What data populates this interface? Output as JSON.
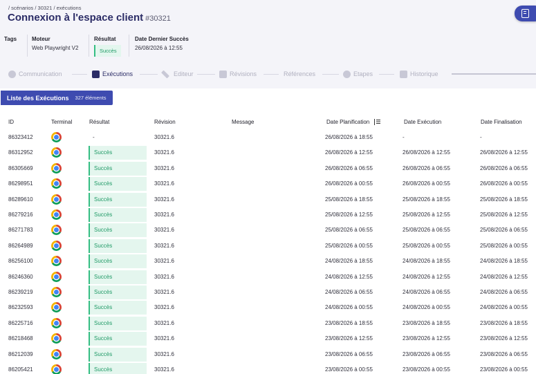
{
  "header": {
    "breadcrumb": "/ scénarios / 30321 / exécutions",
    "title": "Connexion à l'espace client",
    "title_id": "#30321"
  },
  "meta": {
    "tags_label": "Tags",
    "engine_label": "Moteur",
    "engine_value": "Web Playwright V2",
    "result_label": "Résultat",
    "result_value": "Succès",
    "last_success_label": "Date Dernier Succès",
    "last_success_value": "26/08/2026 à 12:55"
  },
  "tabs": [
    {
      "label": "Communication",
      "icon": "circle-icon"
    },
    {
      "label": "Exécutions",
      "icon": "list-icon",
      "active": true
    },
    {
      "label": "Editeur",
      "icon": "pencil-icon"
    },
    {
      "label": "Révisions",
      "icon": "document-icon"
    },
    {
      "label": "Références",
      "icon": ""
    },
    {
      "label": "Etapes",
      "icon": "circle-icon"
    },
    {
      "label": "Historique",
      "icon": "document-icon"
    }
  ],
  "list": {
    "title": "Liste des Exécutions",
    "count": "327 éléments"
  },
  "table": {
    "columns": [
      "ID",
      "Terminal",
      "Résultat",
      "Révision",
      "Message",
      "Date Planification",
      "Date Exécution",
      "Date Finalisation"
    ],
    "rows": [
      {
        "id": "86323412",
        "result": "-",
        "revision": "30321.6",
        "message": "",
        "planned": "26/08/2026 à 18:55",
        "executed": "-",
        "finished": "-"
      },
      {
        "id": "86312952",
        "result": "Succès",
        "revision": "30321.6",
        "message": "",
        "planned": "26/08/2026 à 12:55",
        "executed": "26/08/2026 à 12:55",
        "finished": "26/08/2026 à 12:55"
      },
      {
        "id": "86305669",
        "result": "Succès",
        "revision": "30321.6",
        "message": "",
        "planned": "26/08/2026 à 06:55",
        "executed": "26/08/2026 à 06:55",
        "finished": "26/08/2026 à 06:55"
      },
      {
        "id": "86298951",
        "result": "Succès",
        "revision": "30321.6",
        "message": "",
        "planned": "26/08/2026 à 00:55",
        "executed": "26/08/2026 à 00:55",
        "finished": "26/08/2026 à 00:55"
      },
      {
        "id": "86289610",
        "result": "Succès",
        "revision": "30321.6",
        "message": "",
        "planned": "25/08/2026 à 18:55",
        "executed": "25/08/2026 à 18:55",
        "finished": "25/08/2026 à 18:55"
      },
      {
        "id": "86279216",
        "result": "Succès",
        "revision": "30321.6",
        "message": "",
        "planned": "25/08/2026 à 12:55",
        "executed": "25/08/2026 à 12:55",
        "finished": "25/08/2026 à 12:55"
      },
      {
        "id": "86271783",
        "result": "Succès",
        "revision": "30321.6",
        "message": "",
        "planned": "25/08/2026 à 06:55",
        "executed": "25/08/2026 à 06:55",
        "finished": "25/08/2026 à 06:55"
      },
      {
        "id": "86264989",
        "result": "Succès",
        "revision": "30321.6",
        "message": "",
        "planned": "25/08/2026 à 00:55",
        "executed": "25/08/2026 à 00:55",
        "finished": "25/08/2026 à 00:55"
      },
      {
        "id": "86256100",
        "result": "Succès",
        "revision": "30321.6",
        "message": "",
        "planned": "24/08/2026 à 18:55",
        "executed": "24/08/2026 à 18:55",
        "finished": "24/08/2026 à 18:55"
      },
      {
        "id": "86246360",
        "result": "Succès",
        "revision": "30321.6",
        "message": "",
        "planned": "24/08/2026 à 12:55",
        "executed": "24/08/2026 à 12:55",
        "finished": "24/08/2026 à 12:55"
      },
      {
        "id": "86239219",
        "result": "Succès",
        "revision": "30321.6",
        "message": "",
        "planned": "24/08/2026 à 06:55",
        "executed": "24/08/2026 à 06:55",
        "finished": "24/08/2026 à 06:55"
      },
      {
        "id": "86232593",
        "result": "Succès",
        "revision": "30321.6",
        "message": "",
        "planned": "24/08/2026 à 00:55",
        "executed": "24/08/2026 à 00:55",
        "finished": "24/08/2026 à 00:55"
      },
      {
        "id": "86225716",
        "result": "Succès",
        "revision": "30321.6",
        "message": "",
        "planned": "23/08/2026 à 18:55",
        "executed": "23/08/2026 à 18:55",
        "finished": "23/08/2026 à 18:55"
      },
      {
        "id": "86218468",
        "result": "Succès",
        "revision": "30321.6",
        "message": "",
        "planned": "23/08/2026 à 12:55",
        "executed": "23/08/2026 à 12:55",
        "finished": "23/08/2026 à 12:55"
      },
      {
        "id": "86212039",
        "result": "Succès",
        "revision": "30321.6",
        "message": "",
        "planned": "23/08/2026 à 06:55",
        "executed": "23/08/2026 à 06:55",
        "finished": "23/08/2026 à 06:55"
      },
      {
        "id": "86205421",
        "result": "Succès",
        "revision": "30321.6",
        "message": "",
        "planned": "23/08/2026 à 00:55",
        "executed": "23/08/2026 à 00:55",
        "finished": "23/08/2026 à 00:55"
      }
    ]
  },
  "colors": {
    "brand": "#3e4bb0",
    "title": "#2b2c66",
    "success": "#33bd82",
    "success_bg": "#e4f6ee"
  }
}
